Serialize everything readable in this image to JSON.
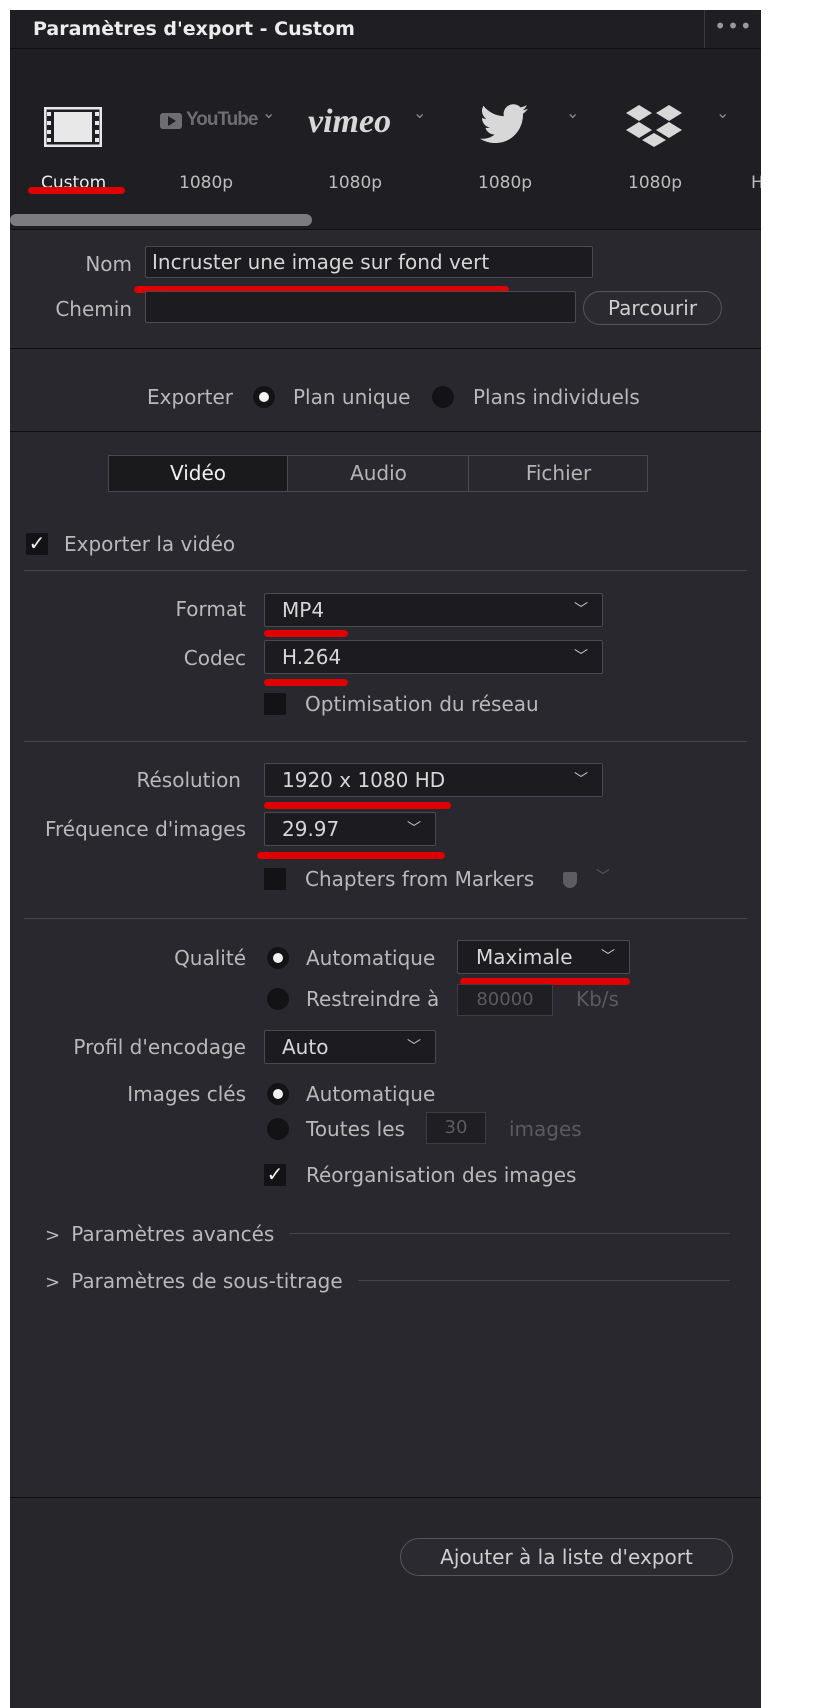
{
  "window": {
    "title": "Paramètres d'export - Custom",
    "menu_icon": "ellipsis-icon"
  },
  "presets": [
    {
      "icon": "film-strip-icon",
      "label": "Custom",
      "selected": true
    },
    {
      "icon": "youtube-logo",
      "logo_text": "YouTube",
      "label": "1080p"
    },
    {
      "icon": "vimeo-logo",
      "logo_text": "vimeo",
      "label": "1080p"
    },
    {
      "icon": "twitter-bird-icon",
      "label": "1080p"
    },
    {
      "icon": "dropbox-icon",
      "label": "1080p"
    },
    {
      "label": "H"
    }
  ],
  "file": {
    "name_label": "Nom",
    "name_value": "Incruster une image sur fond vert",
    "path_label": "Chemin",
    "path_value": "",
    "browse_label": "Parcourir"
  },
  "export_mode": {
    "label": "Exporter",
    "options": [
      "Plan unique",
      "Plans individuels"
    ],
    "selected": "Plan unique"
  },
  "tabs": [
    "Vidéo",
    "Audio",
    "Fichier"
  ],
  "active_tab": "Vidéo",
  "video": {
    "export_video_label": "Exporter la vidéo",
    "export_video_checked": true,
    "format_label": "Format",
    "format_value": "MP4",
    "codec_label": "Codec",
    "codec_value": "H.264",
    "network_opt_label": "Optimisation du réseau",
    "network_opt_checked": false,
    "resolution_label": "Résolution",
    "resolution_value": "1920 x 1080 HD",
    "framerate_label": "Fréquence d'images",
    "framerate_value": "29.97",
    "chapters_label": "Chapters from Markers",
    "chapters_checked": false,
    "quality_label": "Qualité",
    "quality_auto_label": "Automatique",
    "quality_auto_selected": true,
    "quality_value": "Maximale",
    "quality_limit_label": "Restreindre à",
    "quality_limit_value": "80000",
    "quality_limit_unit": "Kb/s",
    "profile_label": "Profil d'encodage",
    "profile_value": "Auto",
    "keyframes_label": "Images clés",
    "keyframes_auto_label": "Automatique",
    "keyframes_auto_selected": true,
    "keyframes_every_label": "Toutes les",
    "keyframes_every_value": "30",
    "keyframes_every_unit": "images",
    "reorder_label": "Réorganisation des images",
    "reorder_checked": true,
    "advanced_label": "Paramètres avancés",
    "subtitles_label": "Paramètres de sous-titrage"
  },
  "footer": {
    "add_button_label": "Ajouter à la liste d'export"
  },
  "colors": {
    "panel_bg": "#28282e",
    "header_bg": "#1f1f23",
    "annotation_red": "#e00000"
  }
}
